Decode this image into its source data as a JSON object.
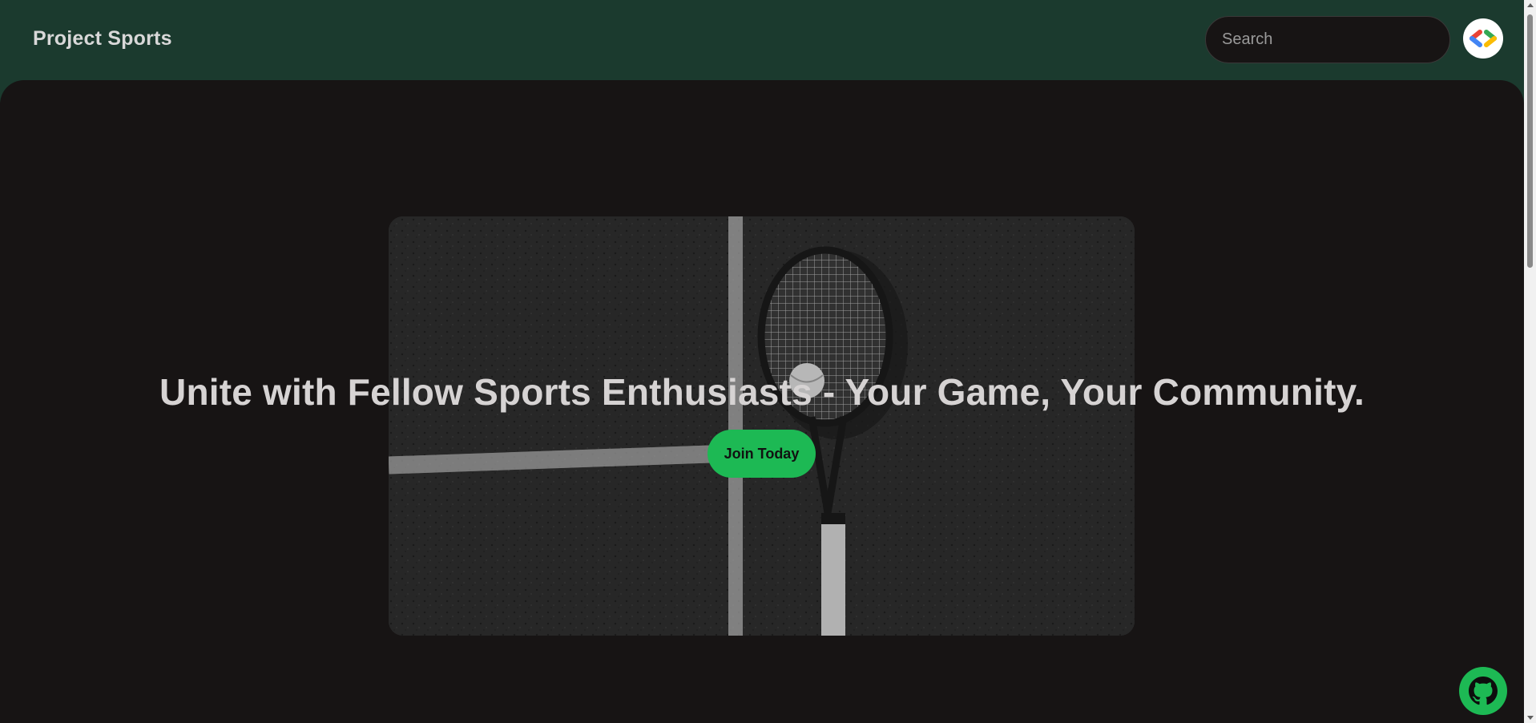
{
  "header": {
    "brand": "Project Sports",
    "search_placeholder": "Search",
    "avatar_icon": "developer-brackets-icon"
  },
  "hero": {
    "headline": "Unite with Fellow Sports Enthusiasts - Your Game, Your Community.",
    "cta_label": "Join Today",
    "image_subject": "tennis-racket-and-ball-on-clay-court-image"
  },
  "footer": {
    "github_icon": "github-icon"
  },
  "colors": {
    "header_bg": "#1b3a2e",
    "main_bg": "#171414",
    "accent": "#1db954",
    "text": "#d6d3d3"
  }
}
